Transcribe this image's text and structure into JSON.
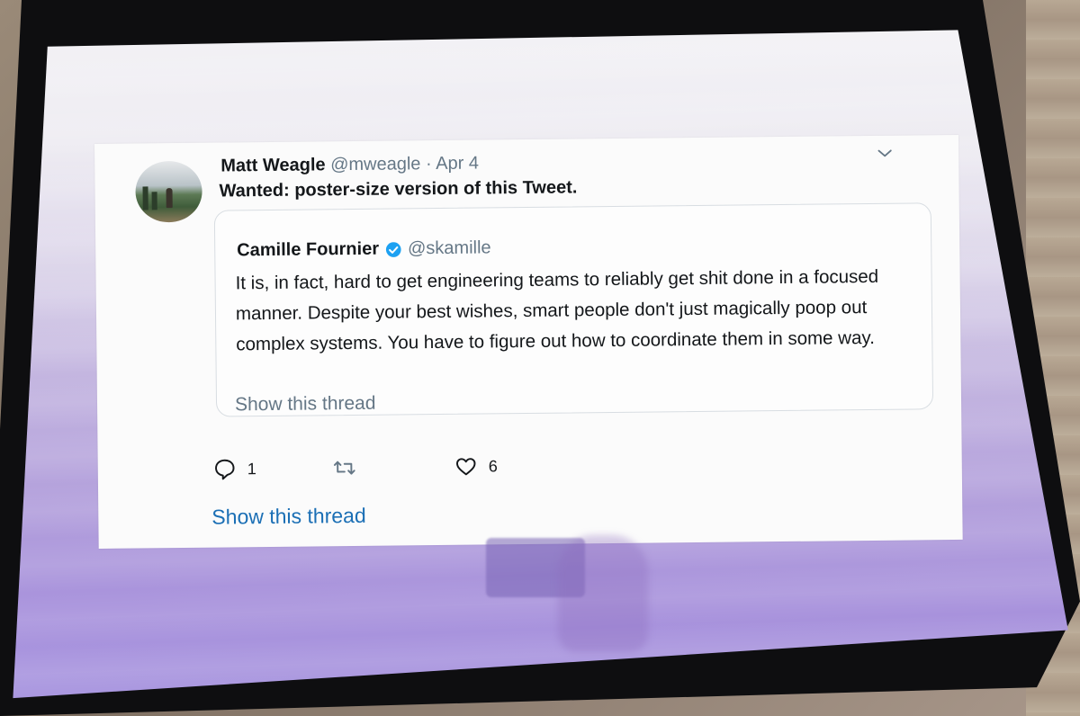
{
  "tweet": {
    "author_name": "Matt Weagle",
    "author_handle": "@mweagle",
    "separator": "·",
    "date": "Apr 4",
    "text_bold": "Wanted",
    "text_rest": ": poster-size version of this Tweet.",
    "menu_icon": "chevron-down-icon"
  },
  "quoted": {
    "author_name": "Camille Fournier",
    "author_handle": "@skamille",
    "verified_icon": "verified-badge-icon",
    "text": "It is, in fact, hard to get engineering teams to reliably get shit done in a focused manner. Despite your best wishes, smart people don't just magically poop out complex systems. You have to figure out how to coordinate them in some way.",
    "show_thread": "Show this thread"
  },
  "actions": {
    "reply_count": "1",
    "retweet_count": "",
    "like_count": "6"
  },
  "show_thread": "Show this thread",
  "colors": {
    "link_blue": "#1b6fb5",
    "verified_blue": "#1da1f2",
    "muted_gray": "#657786",
    "poster_purple": "#a892dc",
    "frame_black": "#0e0e10"
  }
}
